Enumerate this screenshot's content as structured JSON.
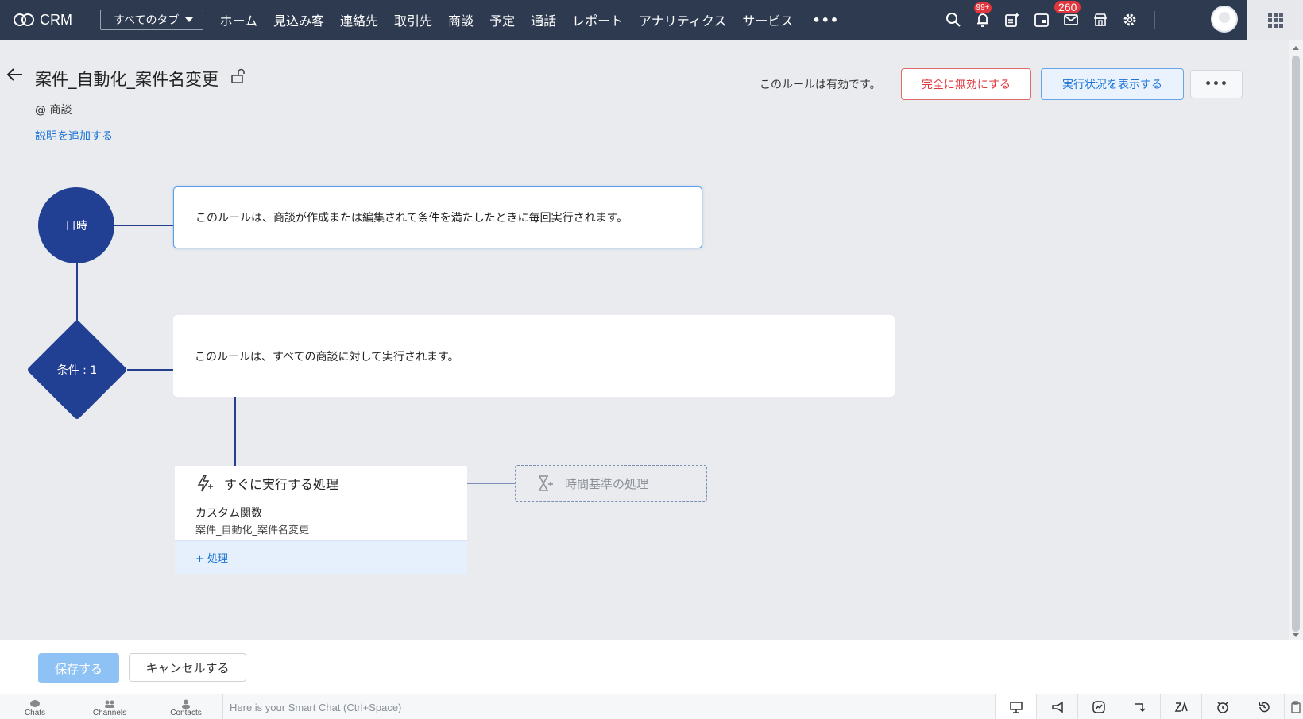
{
  "app": {
    "name": "CRM"
  },
  "nav": {
    "tab_selector": "すべてのタブ",
    "items": [
      "ホーム",
      "見込み客",
      "連絡先",
      "取引先",
      "商談",
      "予定",
      "通話",
      "レポート",
      "アナリティクス",
      "サービス"
    ],
    "more": "•••",
    "notifications_badge": "99+",
    "mail_badge": "260"
  },
  "rule": {
    "title": "案件_自動化_案件名変更",
    "module": "@ 商談",
    "add_description": "説明を追加する",
    "status_text": "このルールは有効です。",
    "disable_label": "完全に無効にする",
    "view_status_label": "実行状況を表示する",
    "more_label": "•••"
  },
  "flow": {
    "trigger_label": "日時",
    "trigger_text": "このルールは、商談が作成または編集されて条件を満たしたときに毎回実行されます。",
    "condition_label": "条件 : 1",
    "condition_text": "このルールは、すべての商談に対して実行されます。",
    "instant_action_title": "すぐに実行する処理",
    "function_type": "カスタム関数",
    "function_name": "案件_自動化_案件名変更",
    "add_action": "+ 処理",
    "scheduled_action": "時間基準の処理"
  },
  "footer": {
    "save": "保存する",
    "cancel": "キャンセルする",
    "chats": "Chats",
    "channels": "Channels",
    "contacts": "Contacts",
    "smartchat_placeholder": "Here is your Smart Chat (Ctrl+Space)"
  },
  "colors": {
    "topbar": "#2d3a4f",
    "node": "#213f93",
    "link": "#1a73d9",
    "danger": "#e0363d"
  }
}
